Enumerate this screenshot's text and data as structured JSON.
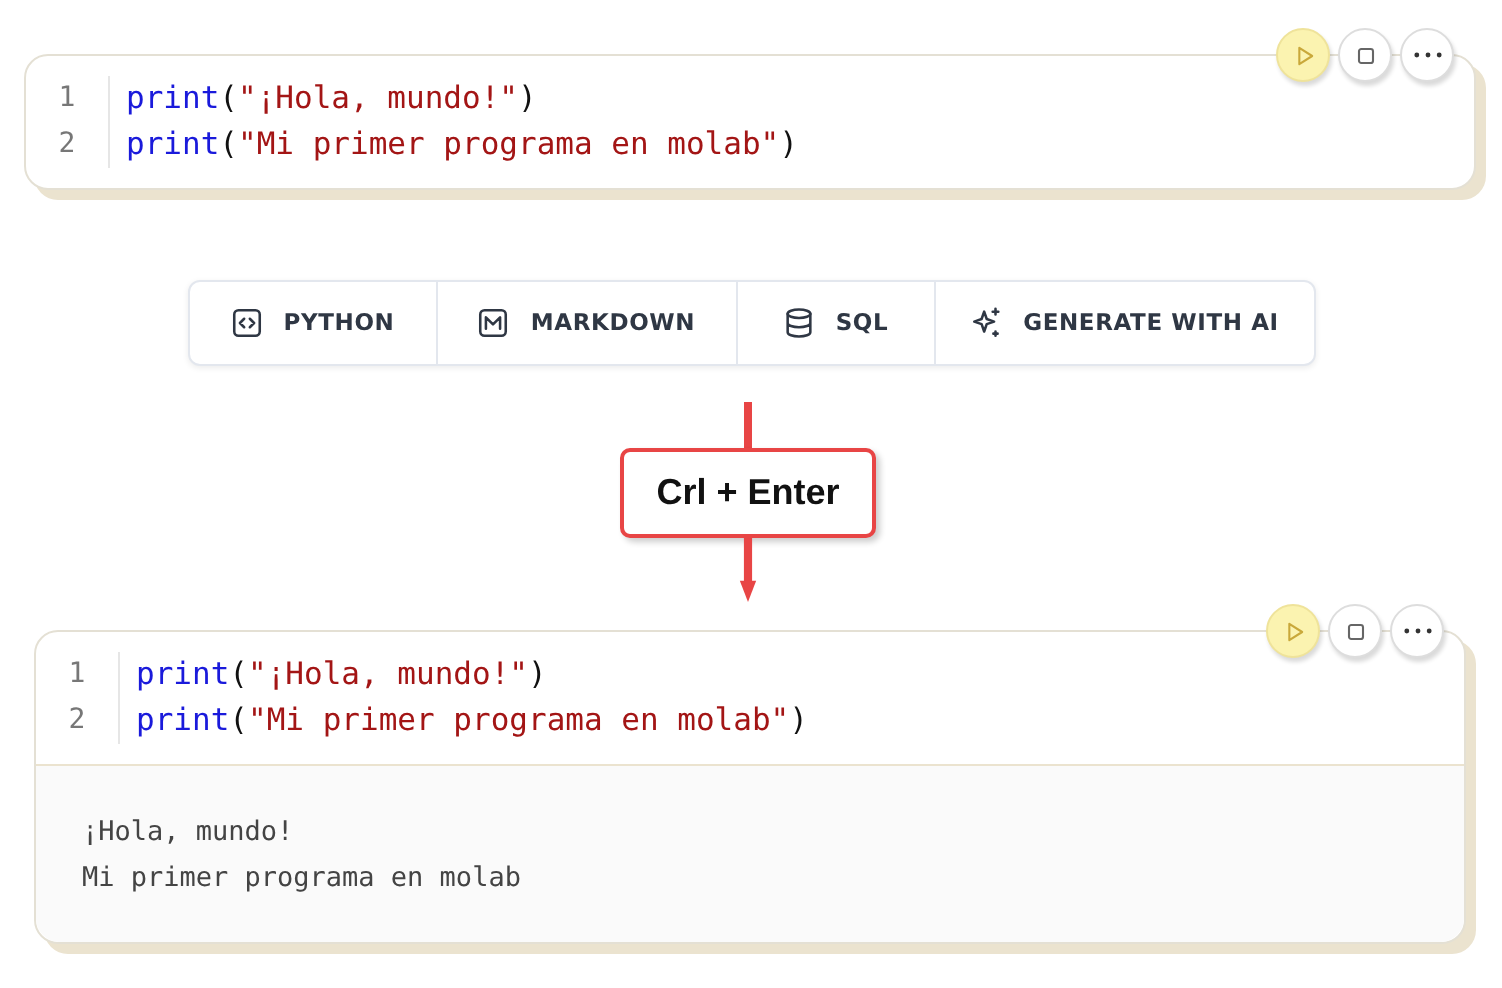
{
  "cells": [
    {
      "lines": [
        {
          "number": "1",
          "tokens": [
            {
              "kind": "function",
              "text": "print"
            },
            {
              "kind": "punct",
              "text": "("
            },
            {
              "kind": "string",
              "text": "\"¡Hola, mundo!\""
            },
            {
              "kind": "punct",
              "text": ")"
            }
          ]
        },
        {
          "number": "2",
          "tokens": [
            {
              "kind": "function",
              "text": "print"
            },
            {
              "kind": "punct",
              "text": "("
            },
            {
              "kind": "string",
              "text": "\"Mi primer programa en molab\""
            },
            {
              "kind": "punct",
              "text": ")"
            }
          ]
        }
      ],
      "buttons": [
        {
          "kind": "run"
        },
        {
          "kind": "stop"
        },
        {
          "kind": "more"
        }
      ]
    },
    {
      "lines": [
        {
          "number": "1",
          "tokens": [
            {
              "kind": "function",
              "text": "print"
            },
            {
              "kind": "punct",
              "text": "("
            },
            {
              "kind": "string",
              "text": "\"¡Hola, mundo!\""
            },
            {
              "kind": "punct",
              "text": ")"
            }
          ]
        },
        {
          "number": "2",
          "tokens": [
            {
              "kind": "function",
              "text": "print"
            },
            {
              "kind": "punct",
              "text": "("
            },
            {
              "kind": "string",
              "text": "\"Mi primer programa en molab\""
            },
            {
              "kind": "punct",
              "text": ")"
            }
          ]
        }
      ],
      "buttons": [
        {
          "kind": "run"
        },
        {
          "kind": "stop"
        },
        {
          "kind": "more"
        }
      ],
      "output": [
        "¡Hola, mundo!",
        "Mi primer programa en molab"
      ]
    }
  ],
  "add_cell_toolbar": [
    {
      "kind": "python",
      "label": "PYTHON"
    },
    {
      "kind": "markdown",
      "label": "MARKDOWN"
    },
    {
      "kind": "sql",
      "label": "SQL"
    },
    {
      "kind": "ai",
      "label": "GENERATE WITH AI"
    }
  ],
  "arrow_label": "Crl + Enter"
}
